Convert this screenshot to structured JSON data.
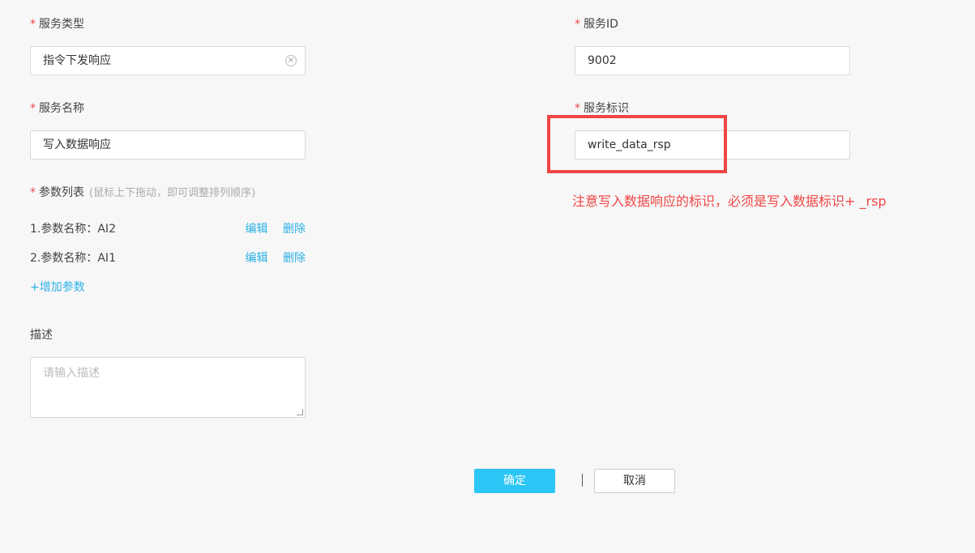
{
  "form": {
    "service_type": {
      "required_mark": "*",
      "label": "服务类型",
      "value": "指令下发响应",
      "clear_icon": "×"
    },
    "service_id": {
      "required_mark": "*",
      "label": "服务ID",
      "value": "9002"
    },
    "service_name": {
      "required_mark": "*",
      "label": "服务名称",
      "value": "写入数据响应"
    },
    "service_identifier": {
      "required_mark": "*",
      "label": "服务标识",
      "value": "write_data_rsp"
    },
    "params": {
      "required_mark": "*",
      "label": "参数列表",
      "hint": "(鼠标上下拖动，即可调整排列顺序)",
      "items": [
        {
          "text": "1.参数名称：AI2",
          "edit": "编辑",
          "delete": "删除"
        },
        {
          "text": "2.参数名称：AI1",
          "edit": "编辑",
          "delete": "删除"
        }
      ],
      "add_label": "+增加参数"
    },
    "description": {
      "label": "描述",
      "placeholder": "请输入描述",
      "value": ""
    }
  },
  "annotation": {
    "note": "注意写入数据响应的标识，必须是写入数据标识+  _rsp",
    "color": "#f04545"
  },
  "actions": {
    "confirm": "确定",
    "cancel": "取消"
  }
}
